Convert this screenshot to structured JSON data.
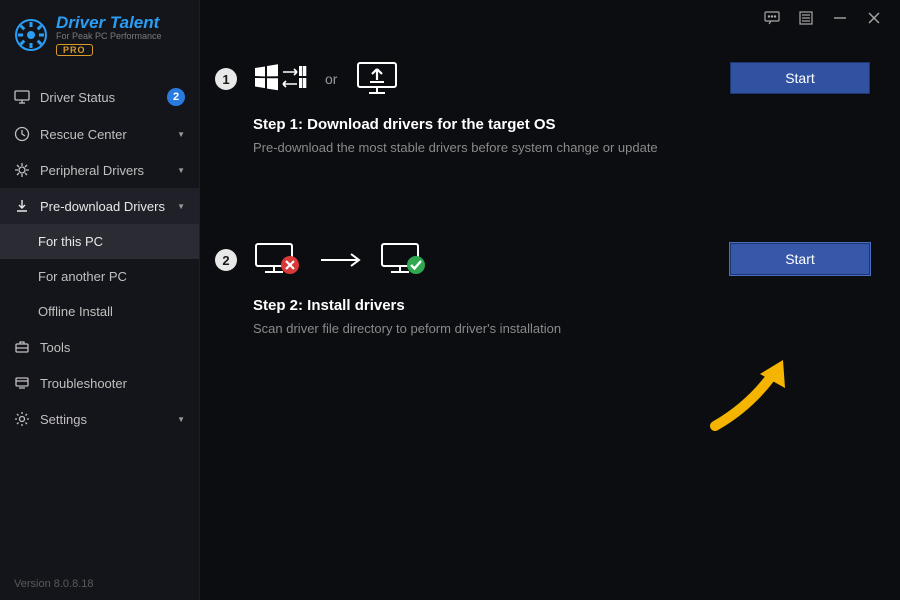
{
  "logo": {
    "title": "Driver Talent",
    "subtitle": "For Peak PC Performance",
    "badge": "PRO"
  },
  "nav": {
    "driver_status": {
      "label": "Driver Status",
      "badge": "2"
    },
    "rescue_center": {
      "label": "Rescue Center"
    },
    "peripheral_drivers": {
      "label": "Peripheral Drivers"
    },
    "pre_download": {
      "label": "Pre-download Drivers"
    },
    "sub_for_this_pc": {
      "label": "For this PC"
    },
    "sub_for_another_pc": {
      "label": "For another PC"
    },
    "sub_offline_install": {
      "label": "Offline Install"
    },
    "tools": {
      "label": "Tools"
    },
    "troubleshooter": {
      "label": "Troubleshooter"
    },
    "settings": {
      "label": "Settings"
    }
  },
  "version": "Version 8.0.8.18",
  "step1": {
    "num": "1",
    "or": "or",
    "title": "Step 1: Download drivers for the target OS",
    "desc": "Pre-download the most stable drivers before system change or update",
    "start": "Start"
  },
  "step2": {
    "num": "2",
    "title": "Step 2: Install drivers",
    "desc": "Scan driver file directory to peform driver's installation",
    "start": "Start"
  }
}
